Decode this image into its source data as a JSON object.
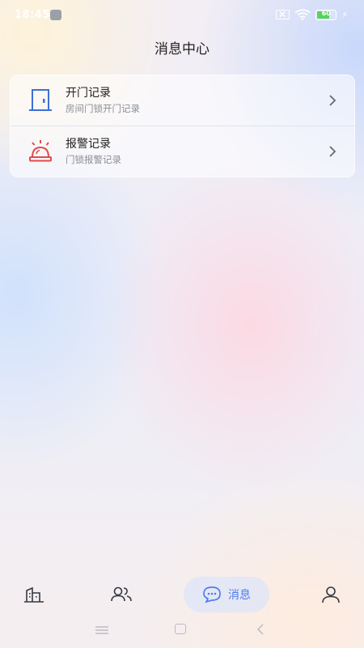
{
  "status_bar": {
    "time": "18:45",
    "battery": "60",
    "battery_fraction": 0.6
  },
  "header": {
    "title": "消息中心"
  },
  "records": [
    {
      "title": "开门记录",
      "subtitle": "房间门锁开门记录",
      "icon": "door-icon",
      "color": "#3e6fd8"
    },
    {
      "title": "报警记录",
      "subtitle": "门锁报警记录",
      "icon": "alarm-bell-icon",
      "color": "#e24a4a"
    }
  ],
  "tabbar": {
    "active": "message",
    "message_label": "消息",
    "accent": "#4d7cf0"
  }
}
